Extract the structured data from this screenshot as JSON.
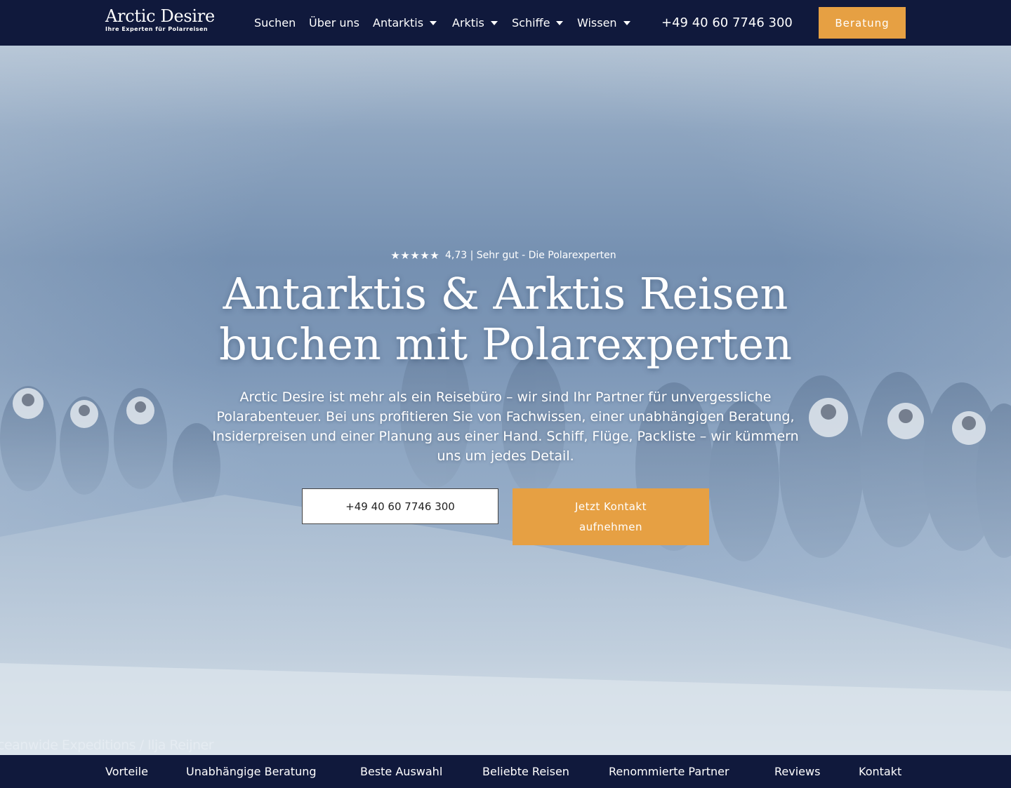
{
  "header": {
    "logo": {
      "title": "Arctic Desire",
      "tagline": "Ihre Experten für Polarreisen"
    },
    "nav": [
      {
        "label": "Suchen",
        "has_dropdown": false
      },
      {
        "label": "Über uns",
        "has_dropdown": false
      },
      {
        "label": "Antarktis",
        "has_dropdown": true
      },
      {
        "label": "Arktis",
        "has_dropdown": true
      },
      {
        "label": "Schiffe",
        "has_dropdown": true
      },
      {
        "label": "Wissen",
        "has_dropdown": true
      }
    ],
    "phone": "+49 40 60 7746 300",
    "cta_label": "Beratung"
  },
  "hero": {
    "rating": {
      "stars": 4.73,
      "max_stars": 5,
      "text": "4,73 | Sehr gut - Die Polarexperten"
    },
    "title_line1": "Antarktis & Arktis Reisen",
    "title_line2": "buchen mit Polarexperten",
    "description": "Arctic Desire ist mehr als ein Reisebüro – wir sind Ihr Partner für unvergessliche Polarabenteuer. Bei uns profitieren Sie von Fachwissen, einer unabhängigen Beratung, Insiderpreisen und einer Planung aus einer Hand. Schiff, Flüge, Packliste – wir kümmern uns um jedes Detail.",
    "phone_button": "+49 40 60 7746 300",
    "contact_button": "Jetzt Kontakt aufnehmen",
    "image_credit": "ceanwide Expeditions / Ilja Reijner"
  },
  "anchor_nav": [
    {
      "label": "Vorteile"
    },
    {
      "label": "Unabhängige Beratung"
    },
    {
      "label": "Beste Auswahl"
    },
    {
      "label": "Beliebte Reisen"
    },
    {
      "label": "Renommierte Partner"
    },
    {
      "label": "Reviews"
    },
    {
      "label": "Kontakt"
    }
  ],
  "colors": {
    "navy": "#10193c",
    "accent": "#e6a043",
    "white": "#ffffff"
  },
  "icons": {
    "dropdown": "caret-down-icon",
    "rating": "star-icon"
  }
}
